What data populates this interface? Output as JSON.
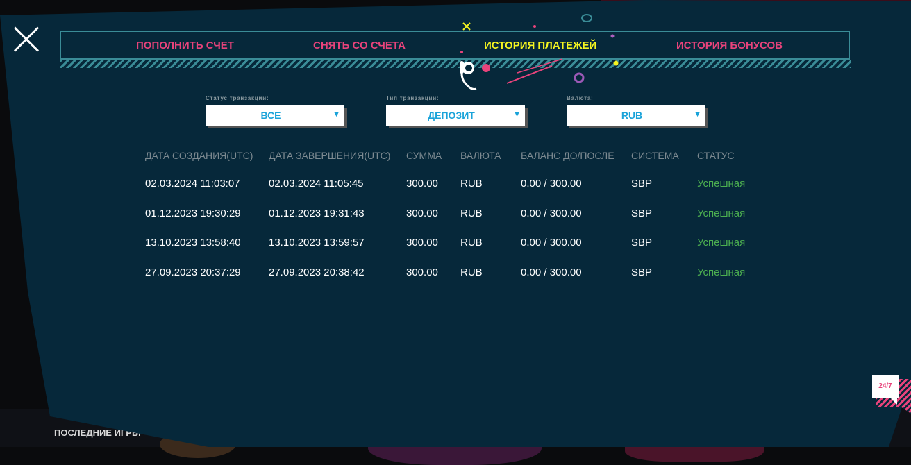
{
  "background": {
    "footer_text": "ПОСЛЕДНИЕ ИГРЫ"
  },
  "tabs": [
    {
      "label": "ПОПОЛНИТЬ СЧЕТ",
      "active": false
    },
    {
      "label": "СНЯТЬ СО СЧЕТА",
      "active": false
    },
    {
      "label": "ИСТОРИЯ ПЛАТЕЖЕЙ",
      "active": true
    },
    {
      "label": "ИСТОРИЯ БОНУСОВ",
      "active": false
    }
  ],
  "filters": {
    "status": {
      "label": "Статус транзакции:",
      "value": "ВСЕ"
    },
    "type": {
      "label": "Тип транзакции:",
      "value": "ДЕПОЗИТ"
    },
    "currency": {
      "label": "Валюта:",
      "value": "RUB"
    }
  },
  "table": {
    "headers": [
      "ДАТА СОЗДАНИЯ(UTC)",
      "ДАТА ЗАВЕРШЕНИЯ(UTC)",
      "СУММА",
      "ВАЛЮТА",
      "БАЛАНС ДО/ПОСЛЕ",
      "СИСТЕМА",
      "СТАТУС"
    ],
    "rows": [
      [
        "02.03.2024 11:03:07",
        "02.03.2024 11:05:45",
        "300.00",
        "RUB",
        "0.00 / 300.00",
        "SBP",
        "Успешная"
      ],
      [
        "01.12.2023 19:30:29",
        "01.12.2023 19:31:43",
        "300.00",
        "RUB",
        "0.00 / 300.00",
        "SBP",
        "Успешная"
      ],
      [
        "13.10.2023 13:58:40",
        "13.10.2023 13:59:57",
        "300.00",
        "RUB",
        "0.00 / 300.00",
        "SBP",
        "Успешная"
      ],
      [
        "27.09.2023 20:37:29",
        "27.09.2023 20:38:42",
        "300.00",
        "RUB",
        "0.00 / 300.00",
        "SBP",
        "Успешная"
      ]
    ]
  },
  "chat": {
    "label": "24/7"
  },
  "colors": {
    "modal_bg": "#06283a",
    "tab_inactive": "#e8437b",
    "tab_active": "#f5f520",
    "accent_teal": "#3a8c97",
    "select_text": "#1aa3d9",
    "status_success": "#4caf50"
  }
}
